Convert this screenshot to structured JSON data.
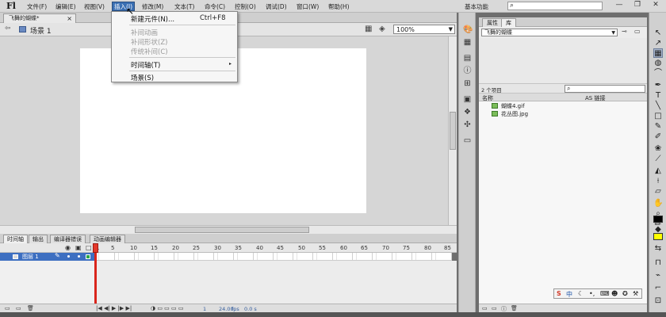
{
  "app": {
    "logo": "Fl",
    "menu": [
      "文件(F)",
      "编辑(E)",
      "视图(V)",
      "插入(I)",
      "修改(M)",
      "文本(T)",
      "命令(C)",
      "控制(O)",
      "调试(D)",
      "窗口(W)",
      "帮助(H)"
    ],
    "workspace": "基本功能",
    "search_icon": "search-icon",
    "window_buttons": [
      "—",
      "❐",
      "✕"
    ]
  },
  "document": {
    "tab_title": "飞舞的蝴蝶*",
    "tab_close": "×",
    "scene": "场景 1",
    "zoom": "100%"
  },
  "insert_menu": {
    "items": [
      {
        "label": "新建元件(N)...",
        "shortcut": "Ctrl+F8",
        "disabled": false
      },
      {
        "label": "补间动画",
        "disabled": true
      },
      {
        "label": "补间形状(Z)",
        "disabled": true
      },
      {
        "label": "传统补间(C)",
        "disabled": true
      },
      {
        "label": "时间轴(T)",
        "submenu": true,
        "disabled": false
      },
      {
        "label": "场景(S)",
        "disabled": false
      }
    ],
    "submenu_arrow": "▸"
  },
  "timeline": {
    "tabs": [
      "时间轴",
      "输出",
      "编译器错误",
      "动画编辑器"
    ],
    "ruler": [
      "1",
      "5",
      "10",
      "15",
      "20",
      "25",
      "30",
      "35",
      "40",
      "45",
      "50",
      "55",
      "60",
      "65",
      "70",
      "75",
      "80",
      "85"
    ],
    "layer_name": "图层 1",
    "footer": {
      "frame": "1",
      "fps": "24.00",
      "fps_unit": "fps",
      "time": "0.0 s"
    }
  },
  "library": {
    "tabs": [
      "属性",
      "库"
    ],
    "active_tab": "库",
    "document_select": "飞舞的蝴蝶",
    "item_count": "2 个项目",
    "columns": {
      "name": "名称",
      "linkage": "AS 链接"
    },
    "items": [
      {
        "name": "蝴蝶4.gif",
        "icon": "bitmap-icon"
      },
      {
        "name": "花丛图.jpg",
        "icon": "bitmap-icon"
      }
    ],
    "ime_label": "中"
  },
  "colors": {
    "accent": "#3d6fc1",
    "stroke_swatch": "#000000",
    "fill_swatch": "#ffff00",
    "playhead": "#d9251c"
  }
}
